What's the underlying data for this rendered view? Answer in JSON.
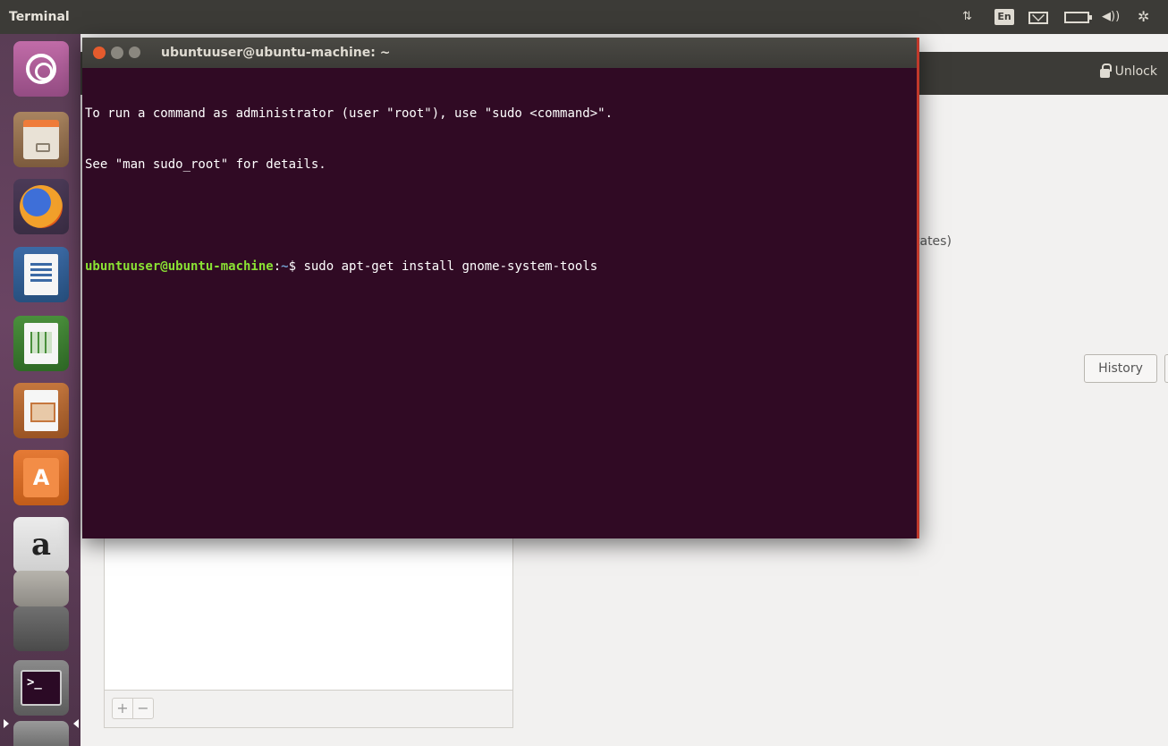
{
  "top_panel": {
    "app_title": "Terminal",
    "indicators": {
      "network_icon": "network-arrows-icon",
      "language": "En",
      "mail_icon": "mail-icon",
      "battery_icon": "battery-icon",
      "volume_icon": "volume-icon",
      "session_icon": "gear-icon",
      "network_glyph": "⇅",
      "volume_glyph": "◀))",
      "session_glyph": "✲"
    }
  },
  "background_window": {
    "unlock_label": "Unlock",
    "partial_text": "tates)",
    "history_label": "History",
    "list_toolbar": {
      "add_label": "+",
      "remove_label": "−"
    }
  },
  "launcher": {
    "items": [
      {
        "name": "dash-home",
        "icon": "ubuntu-logo-icon"
      },
      {
        "name": "files",
        "icon": "file-cabinet-icon"
      },
      {
        "name": "firefox",
        "icon": "firefox-icon"
      },
      {
        "name": "libreoffice-writer",
        "icon": "writer-document-icon"
      },
      {
        "name": "libreoffice-calc",
        "icon": "calc-spreadsheet-icon"
      },
      {
        "name": "libreoffice-impress",
        "icon": "impress-presentation-icon"
      },
      {
        "name": "ubuntu-software",
        "icon": "shopping-bag-icon",
        "glyph": "A"
      },
      {
        "name": "amazon",
        "icon": "amazon-icon",
        "glyph": "a"
      },
      {
        "name": "system-settings",
        "icon": "settings-icon"
      },
      {
        "name": "software-updater",
        "icon": "tools-icon"
      },
      {
        "name": "terminal",
        "icon": "terminal-icon",
        "glyph": ">_"
      },
      {
        "name": "trash",
        "icon": "trash-icon"
      }
    ]
  },
  "terminal": {
    "title": "ubuntuuser@ubuntu-machine: ~",
    "lines": [
      "To run a command as administrator (user \"root\"), use \"sudo <command>\".",
      "See \"man sudo_root\" for details.",
      ""
    ],
    "prompt": {
      "user_host": "ubuntuuser@ubuntu-machine",
      "separator": ":",
      "path": "~",
      "symbol": "$ ",
      "command": "sudo apt-get install gnome-system-tools"
    }
  },
  "colors": {
    "terminal_bg": "#300a24",
    "panel_bg": "#3c3b37",
    "prompt_user": "#8ae234",
    "prompt_path": "#729fcf",
    "close_button": "#e55b2d"
  }
}
